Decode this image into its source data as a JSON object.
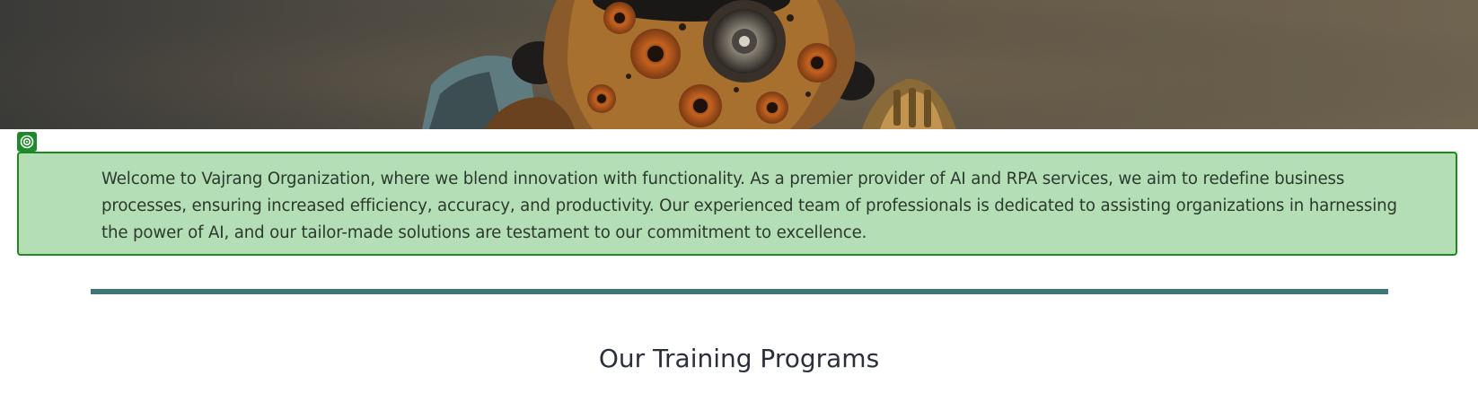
{
  "hero": {
    "image_subject": "steampunk-robot-illustration"
  },
  "intro": {
    "text": "Welcome to Vajrang Organization, where we blend innovation with functionality. As a premier provider of AI and RPA services, we aim to redefine business processes, ensuring increased efficiency, accuracy, and productivity. Our experienced team of professionals is dedicated to assisting organizations in harnessing the power of AI, and our tailor-made solutions are testament to our commitment to excellence."
  },
  "section": {
    "title": "Our Training Programs"
  },
  "colors": {
    "intro_background": "#b3deb6",
    "intro_border": "#1c8a1c",
    "divider": "#3f7778",
    "title_text": "#2b2f3a"
  },
  "icons": {
    "marker": "target-icon"
  }
}
